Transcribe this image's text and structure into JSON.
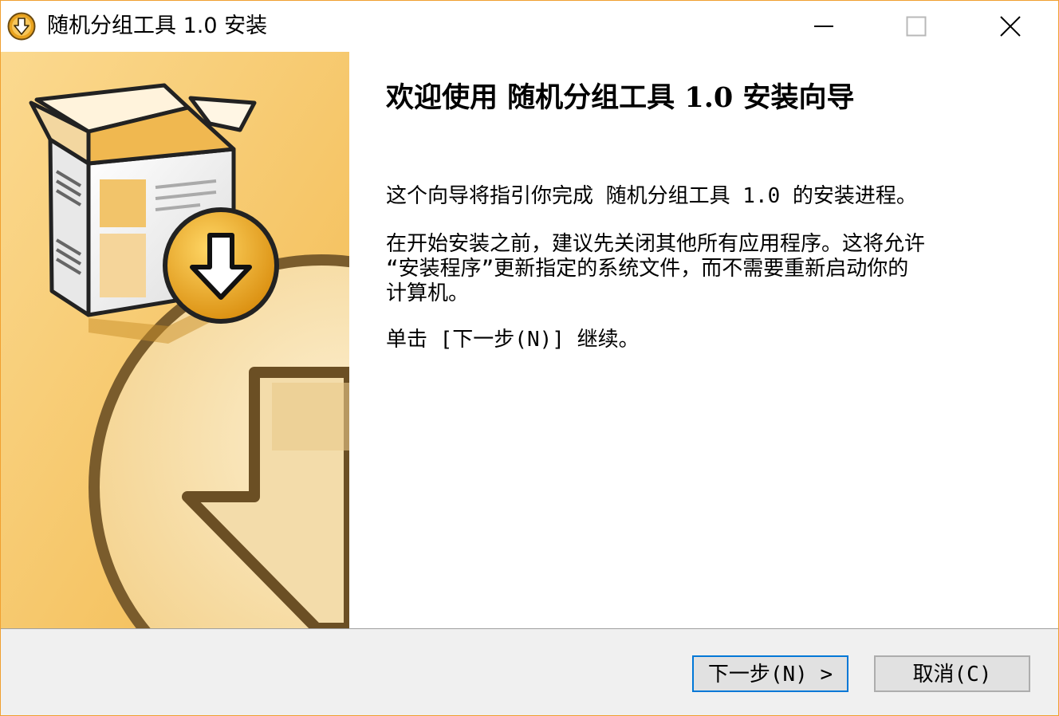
{
  "window": {
    "title": "随机分组工具 1.0 安装"
  },
  "controls": {
    "minimize_icon": "minimize-icon",
    "maximize_icon": "maximize-icon",
    "close_icon": "close-icon"
  },
  "content": {
    "heading": "欢迎使用 随机分组工具 1.0 安装向导",
    "paragraph1": "这个向导将指引你完成 随机分组工具 1.0 的安装进程。",
    "paragraph2_line1": "在开始安装之前，建议先关闭其他所有应用程序。这将允许",
    "paragraph2_line2": "“安装程序”更新指定的系统文件，而不需要重新启动你的",
    "paragraph2_line3": "计算机。",
    "paragraph3": "单击 [下一步(N)] 继续。"
  },
  "buttons": {
    "next_label": "下一步(N) >",
    "cancel_label": "取消(C)"
  },
  "colors": {
    "window_border": "#f0a030",
    "banner_background": "#f7c76a",
    "default_button_border": "#0078d7"
  }
}
